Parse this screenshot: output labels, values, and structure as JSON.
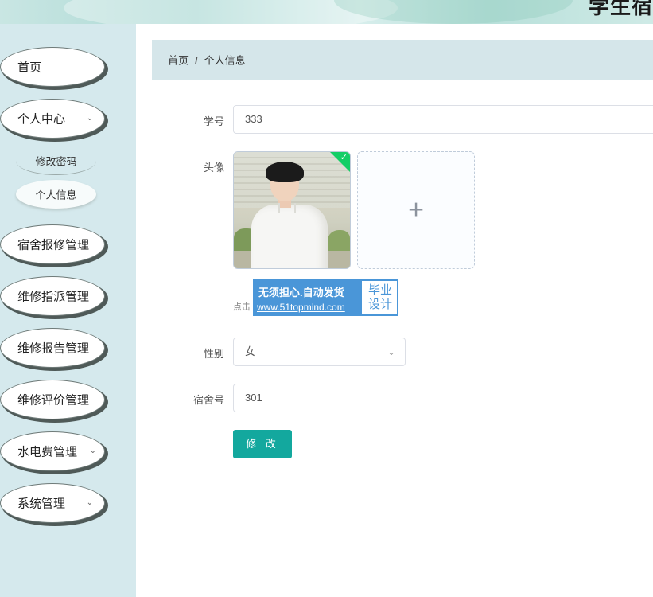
{
  "header": {
    "site_title": "学生宿"
  },
  "sidebar": {
    "items": [
      {
        "label": "首页"
      },
      {
        "label": "个人中心",
        "expanded": true
      },
      {
        "label": "宿舍报修管理"
      },
      {
        "label": "维修指派管理"
      },
      {
        "label": "维修报告管理"
      },
      {
        "label": "维修评价管理"
      },
      {
        "label": "水电费管理",
        "has_children": true
      },
      {
        "label": "系统管理",
        "has_children": true
      }
    ],
    "subitems": [
      {
        "label": "修改密码"
      },
      {
        "label": "个人信息",
        "active": true
      }
    ]
  },
  "breadcrumb": {
    "home": "首页",
    "separator": "/",
    "current": "个人信息"
  },
  "form": {
    "student_id": {
      "label": "学号",
      "value": "333"
    },
    "avatar": {
      "label": "头像",
      "uploaded": true,
      "upload_icon": "plus-icon",
      "tip": "点击"
    },
    "gender": {
      "label": "性别",
      "value": "女"
    },
    "dorm": {
      "label": "宿舍号",
      "value": "301"
    },
    "submit_label": "修 改"
  },
  "watermark": {
    "line1": "无须担心.自动发货",
    "line2": "www.51topmind.com",
    "right": "毕业设计"
  },
  "colors": {
    "sidebar_bg": "#d5e9ed",
    "breadcrumb_bg": "#d5e6ea",
    "primary_button": "#13a89e",
    "success_check": "#13ce66"
  }
}
